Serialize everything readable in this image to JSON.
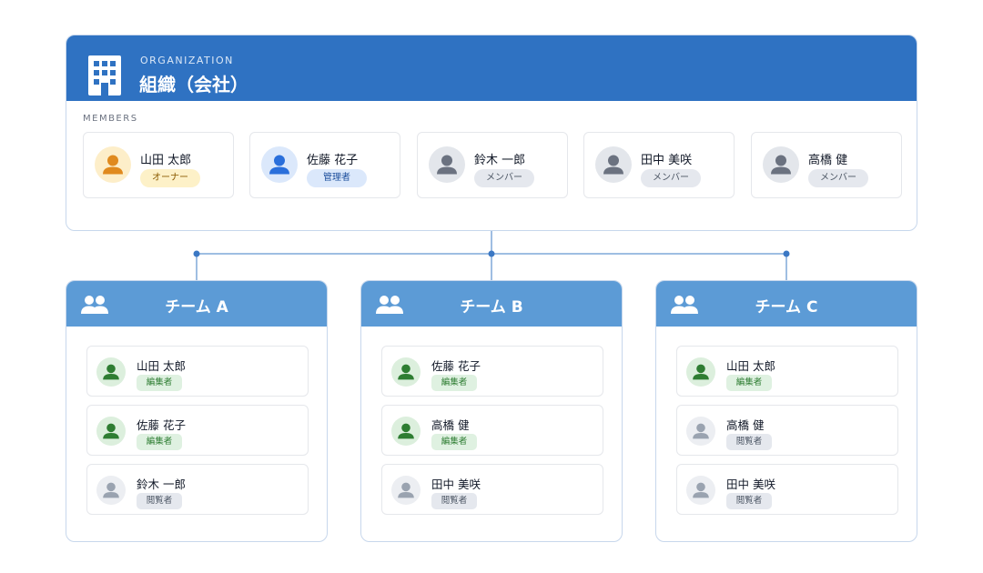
{
  "colors": {
    "org_header": "#2f72c2",
    "team_header": "#5c9bd6",
    "connector": "#3b78c4",
    "owner": "#e08a1e",
    "admin": "#2a6fdb",
    "member": "#6b7280",
    "editor": "#2e7d32",
    "viewer": "#9aa3b0"
  },
  "organization": {
    "kicker": "ORGANIZATION",
    "title": "組織（会社）",
    "icon": "building-icon",
    "members_label": "MEMBERS",
    "members": [
      {
        "name": "山田 太郎",
        "role": "オーナー",
        "kind": "owner"
      },
      {
        "name": "佐藤 花子",
        "role": "管理者",
        "kind": "admin"
      },
      {
        "name": "鈴木 一郎",
        "role": "メンバー",
        "kind": "member"
      },
      {
        "name": "田中 美咲",
        "role": "メンバー",
        "kind": "member"
      },
      {
        "name": "高橋 健",
        "role": "メンバー",
        "kind": "member"
      }
    ]
  },
  "teams": [
    {
      "title": "チーム A",
      "icon": "people-icon",
      "members": [
        {
          "name": "山田 太郎",
          "role": "編集者",
          "kind": "editor"
        },
        {
          "name": "佐藤 花子",
          "role": "編集者",
          "kind": "editor"
        },
        {
          "name": "鈴木 一郎",
          "role": "閲覧者",
          "kind": "viewer"
        }
      ]
    },
    {
      "title": "チーム B",
      "icon": "people-icon",
      "members": [
        {
          "name": "佐藤 花子",
          "role": "編集者",
          "kind": "editor"
        },
        {
          "name": "高橋 健",
          "role": "編集者",
          "kind": "editor"
        },
        {
          "name": "田中 美咲",
          "role": "閲覧者",
          "kind": "viewer"
        }
      ]
    },
    {
      "title": "チーム C",
      "icon": "people-icon",
      "members": [
        {
          "name": "山田 太郎",
          "role": "編集者",
          "kind": "editor"
        },
        {
          "name": "高橋 健",
          "role": "閲覧者",
          "kind": "viewer"
        },
        {
          "name": "田中 美咲",
          "role": "閲覧者",
          "kind": "viewer"
        }
      ]
    }
  ]
}
